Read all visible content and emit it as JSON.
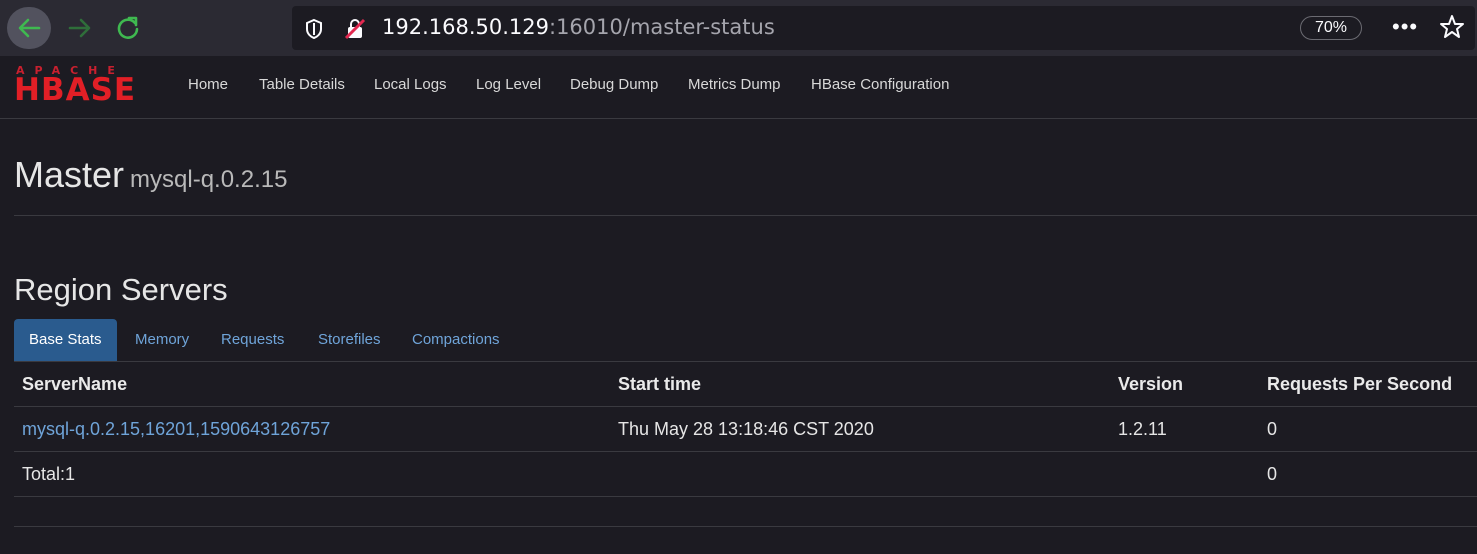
{
  "browser": {
    "url_host": "192.168.50.129",
    "url_path": ":16010/master-status",
    "zoom": "70%",
    "more_label": "•••",
    "icons": {
      "back": "arrow-left-icon",
      "forward": "arrow-right-icon",
      "reload": "reload-icon",
      "shield": "shield-icon",
      "insecure": "insecure-lock-icon",
      "bookmark": "star-icon"
    },
    "colors": {
      "accent_green": "#3fb950",
      "insecure_red": "#e22850"
    }
  },
  "navbar": {
    "logo_top": "APACHE",
    "logo_main": "HBASE",
    "items": [
      "Home",
      "Table Details",
      "Local Logs",
      "Log Level",
      "Debug Dump",
      "Metrics Dump",
      "HBase Configuration"
    ]
  },
  "master": {
    "title": "Master",
    "host": "mysql-q.0.2.15"
  },
  "region_servers": {
    "title": "Region Servers",
    "tabs": [
      "Base Stats",
      "Memory",
      "Requests",
      "Storefiles",
      "Compactions"
    ],
    "active_tab": "Base Stats",
    "columns": [
      "ServerName",
      "Start time",
      "Version",
      "Requests Per Second"
    ],
    "rows": [
      {
        "server_name": "mysql-q.0.2.15,16201,1590643126757",
        "start_time": "Thu May 28 13:18:46 CST 2020",
        "version": "1.2.11",
        "requests_per_second": "0"
      }
    ],
    "total": {
      "label": "Total:1",
      "requests_per_second": "0"
    }
  }
}
